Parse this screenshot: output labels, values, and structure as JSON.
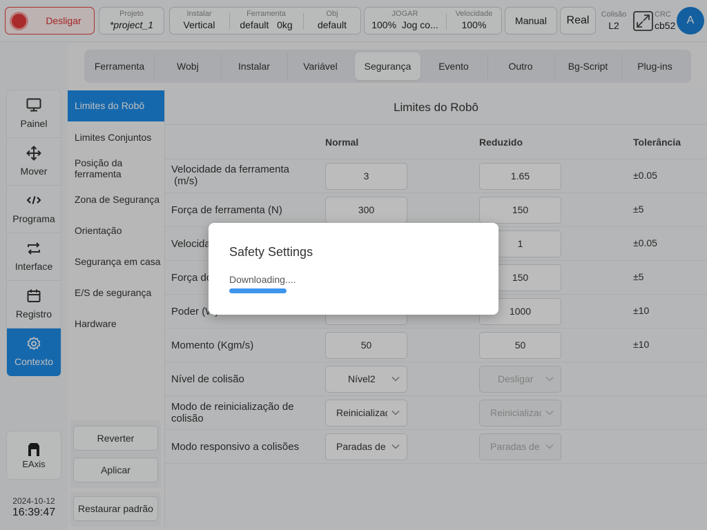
{
  "topbar": {
    "power_label": "Desligar",
    "project": {
      "key": "Projeto",
      "value": "*project_1"
    },
    "install": [
      {
        "key": "Instalar",
        "value": "Vertical"
      },
      {
        "key": "Ferramenta",
        "value": "default   0kg"
      },
      {
        "key": "Obj",
        "value": "default"
      }
    ],
    "jog": [
      {
        "key": "JOGAR",
        "value": "100%  Jog co..."
      },
      {
        "key": "Velocidade",
        "value": "100%"
      }
    ],
    "mode_label": "Manual",
    "real_label": "Real",
    "collision": {
      "key": "Colisão",
      "value": "L2"
    },
    "crc": {
      "key": "CRC",
      "value": "cb52"
    },
    "avatar": "A",
    "colors": {
      "accent": "#1e8be6",
      "power": "#e33a3a"
    }
  },
  "nav": {
    "items": [
      {
        "label": "Painel",
        "icon": "monitor-icon"
      },
      {
        "label": "Mover",
        "icon": "move-arrows-icon"
      },
      {
        "label": "Programa",
        "icon": "code-icon"
      },
      {
        "label": "Interface",
        "icon": "swap-arrows-icon"
      },
      {
        "label": "Registro",
        "icon": "calendar-icon"
      },
      {
        "label": "Contexto",
        "icon": "gear-icon"
      }
    ],
    "active": "Contexto",
    "eaxis_label": "EAxis",
    "date": "2024-10-12",
    "time": "16:39:47"
  },
  "tabs": [
    "Ferramenta",
    "Wobj",
    "Instalar",
    "Variável",
    "Segurança",
    "Evento",
    "Outro",
    "Bg-Script",
    "Plug-ins"
  ],
  "active_tab": "Segurança",
  "sidebar": {
    "items": [
      "Limites do Robô",
      "Limites Conjuntos",
      "Posição da ferramenta",
      "Zona de Segurança",
      "Orientação",
      "Segurança em casa",
      "E/S de segurança",
      "Hardware"
    ],
    "active": "Limites do Robô",
    "revert_label": "Reverter",
    "apply_label": "Aplicar",
    "restore_label": "Restaurar padrão"
  },
  "panel": {
    "title": "Limites do Robô",
    "headers": {
      "normal": "Normal",
      "reduced": "Reduzido",
      "tolerance": "Tolerância"
    },
    "rows": [
      {
        "label": "Velocidade da ferramenta\n (m/s)",
        "normal": "3",
        "reduced": "1.65",
        "tolerance": "±0.05"
      },
      {
        "label": "Força de ferramenta  (N)",
        "normal": "300",
        "reduced": "150",
        "tolerance": "±5"
      },
      {
        "label": "Velocidade",
        "normal": "",
        "reduced": "1",
        "tolerance": "±0.05"
      },
      {
        "label": "Força do",
        "normal": "",
        "reduced": "150",
        "tolerance": "±5"
      },
      {
        "label": "Poder  (W)",
        "normal": "",
        "reduced": "1000",
        "tolerance": "±10"
      },
      {
        "label": "Momento  (Kgm/s)",
        "normal": "50",
        "reduced": "50",
        "tolerance": "±10"
      }
    ],
    "selects": [
      {
        "label": "Nível de colisão",
        "normal": "Nível2",
        "reduced": "Desligar"
      },
      {
        "label": "Modo de reinicialização de\ncolisão",
        "normal": "Reinicialização",
        "reduced": "Reinicialização"
      },
      {
        "label": "Modo responsivo a colisões",
        "normal": "Paradas de",
        "reduced": "Paradas de"
      }
    ]
  },
  "modal": {
    "title": "Safety Settings",
    "status": "Downloading....",
    "progress": 0.23
  }
}
